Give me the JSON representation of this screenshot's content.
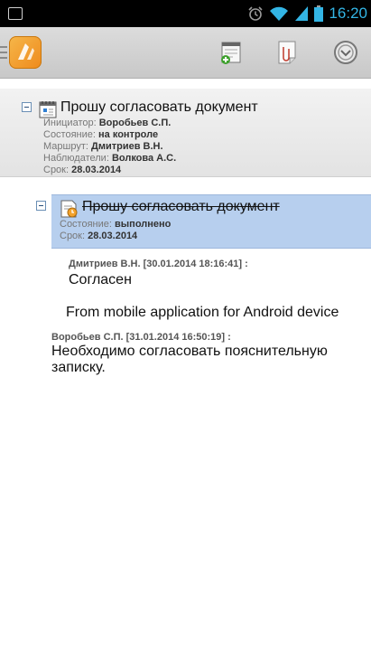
{
  "status_bar": {
    "time": "16:20"
  },
  "action_bar": {
    "app_icon": "app-logo-icon",
    "actions": [
      "new-document-icon",
      "attachment-icon",
      "menu-circle-icon"
    ]
  },
  "task": {
    "title": "Прошу согласовать документ",
    "initiator_label": "Инициатор:",
    "initiator": "Воробьев С.П.",
    "state_label": "Состояние:",
    "state": "на контроле",
    "route_label": "Маршрут:",
    "route": "Дмитриев В.Н.",
    "watchers_label": "Наблюдатели:",
    "watchers": "Волкова А.С.",
    "due_label": "Срок:",
    "due": "28.03.2014"
  },
  "subtask": {
    "title": "Прошу согласовать документ",
    "state_label": "Состояние:",
    "state": "выполнено",
    "due_label": "Срок:",
    "due": "28.03.2014"
  },
  "comments": [
    {
      "author": "Дмитриев В.Н. [30.01.2014 18:16:41] :",
      "text": "Согласен",
      "extra": "From mobile application for Android device"
    },
    {
      "author": "Воробьев С.П. [31.01.2014 16:50:19] :",
      "text": "Необходимо согласовать пояснительную записку."
    }
  ],
  "colors": {
    "status_accent": "#33b5e5",
    "selected_row": "#b7cfee",
    "app_logo": "#f0931f"
  }
}
